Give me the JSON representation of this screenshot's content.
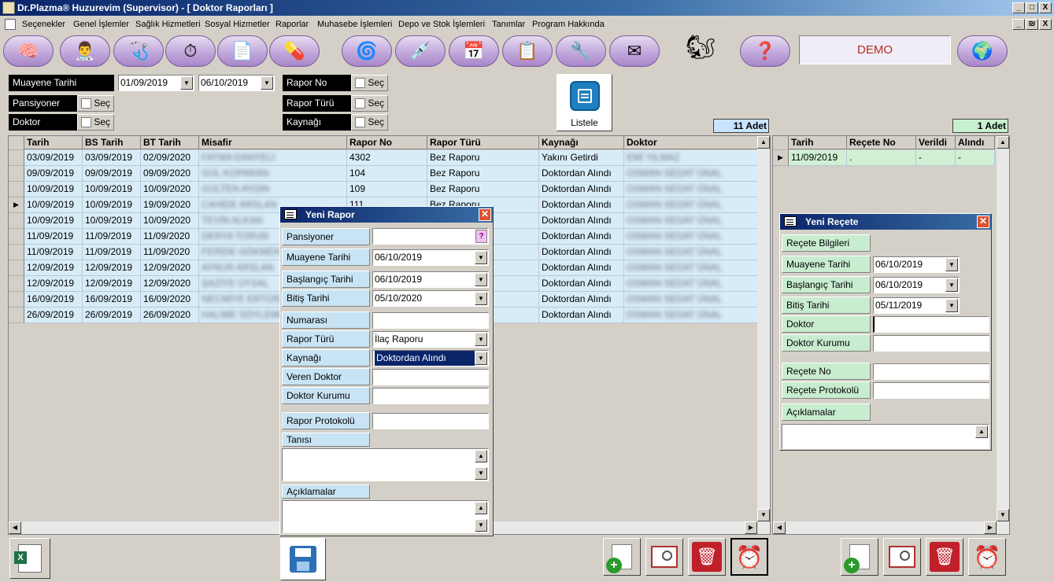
{
  "window": {
    "title": "Dr.Plazma® Huzurevim (Supervisor) - [ Doktor Raporları ]",
    "min": "_",
    "max": "□",
    "close": "X",
    "child_min": "_",
    "child_restore": "₪",
    "child_close": "X"
  },
  "menu": [
    "Seçenekler",
    "Genel İşlemler",
    "Sağlık Hizmetleri",
    "Sosyal Hizmetler",
    "Raporlar",
    "Muhasebe İşlemleri",
    "Depo ve Stok İşlemleri",
    "Tanımlar",
    "Program Hakkında"
  ],
  "toolbar": {
    "demo_label": "DEMO",
    "icons": [
      "help-head-icon",
      "doctors-icon",
      "medical-icon",
      "clock-icon",
      "word-doc-icon",
      "pills-icon",
      "spiral-icon",
      "syringe-icon",
      "calendar-icon",
      "clipboard-icon",
      "tools-icon",
      "mail-icon",
      "squirrel-icon",
      "help-note-icon",
      "globe-icon"
    ]
  },
  "filters": {
    "muayene_label": "Muayene Tarihi",
    "date_from": "01/09/2019",
    "date_to": "06/10/2019",
    "pansiyoner_label": "Pansiyoner",
    "doktor_label": "Doktor",
    "rapor_no_label": "Rapor No",
    "rapor_turu_label": "Rapor Türü",
    "kaynagi_label": "Kaynağı",
    "sec_label": "Seç",
    "list_button": "Listele"
  },
  "counts": {
    "main": "11 Adet",
    "recipe": "1 Adet"
  },
  "main_table": {
    "columns": [
      "Tarih",
      "BS Tarih",
      "BT Tarih",
      "Misafir",
      "Rapor No",
      "Rapor Türü",
      "Kaynağı",
      "Doktor"
    ],
    "rows": [
      [
        "03/09/2019",
        "03/09/2019",
        "02/09/2020",
        "FATMA DANYELİ",
        "4302",
        "Bez Raporu",
        "Yakını Getirdi",
        "EMİ YILMAZ"
      ],
      [
        "09/09/2019",
        "09/09/2019",
        "09/09/2020",
        "GÜL KOPARAN",
        "104",
        "Bez Raporu",
        "Doktordan Alındı",
        "OSMAN SEDAT ÜNAL"
      ],
      [
        "10/09/2019",
        "10/09/2019",
        "10/09/2020",
        "GÜLTEN AYDIN",
        "109",
        "Bez Raporu",
        "Doktordan Alındı",
        "OSMAN SEDAT ÜNAL"
      ],
      [
        "10/09/2019",
        "10/09/2019",
        "19/09/2020",
        "CAHİDE ARSLAN",
        "111",
        "Bez Raporu",
        "Doktordan Alındı",
        "OSMAN SEDAT ÜNAL"
      ],
      [
        "10/09/2019",
        "10/09/2019",
        "10/09/2020",
        "TEVİN ALKAN",
        "",
        "",
        "Doktordan Alındı",
        "OSMAN SEDAT ÜNAL"
      ],
      [
        "11/09/2019",
        "11/09/2019",
        "11/09/2020",
        "DERYA TORUN",
        "",
        "",
        "Doktordan Alındı",
        "OSMAN SEDAT ÜNAL"
      ],
      [
        "11/09/2019",
        "11/09/2019",
        "11/09/2020",
        "FERİDE GÖKMEN",
        "",
        "",
        "Doktordan Alındı",
        "OSMAN SEDAT ÜNAL"
      ],
      [
        "12/09/2019",
        "12/09/2019",
        "12/09/2020",
        "AYNUR ARSLAN",
        "",
        "",
        "Doktordan Alındı",
        "OSMAN SEDAT ÜNAL"
      ],
      [
        "12/09/2019",
        "12/09/2019",
        "12/09/2020",
        "ŞAZİYE UYSAL",
        "",
        "",
        "Doktordan Alındı",
        "OSMAN SEDAT ÜNAL"
      ],
      [
        "16/09/2019",
        "16/09/2019",
        "16/09/2020",
        "NECMİYE ERTÜRK",
        "",
        "",
        "Doktordan Alındı",
        "OSMAN SEDAT ÜNAL"
      ],
      [
        "26/09/2019",
        "26/09/2019",
        "26/09/2020",
        "HALİME SÖYLEMEZ",
        "",
        "",
        "Doktordan Alındı",
        "OSMAN SEDAT ÜNAL"
      ]
    ],
    "selected_row": 3
  },
  "recipe_table": {
    "columns": [
      "Tarih",
      "Reçete No",
      "Verildi",
      "Alındı"
    ],
    "rows": [
      [
        "11/09/2019",
        ".",
        "-",
        "-"
      ]
    ]
  },
  "yeni_rapor": {
    "title": "Yeni Rapor",
    "pansiyoner_label": "Pansiyoner",
    "pansiyoner_value": "",
    "pick_button": "?",
    "muayene_label": "Muayene Tarihi",
    "muayene_value": "06/10/2019",
    "baslangic_label": "Başlangıç Tarihi",
    "baslangic_value": "06/10/2019",
    "bitis_label": "Bitiş Tarihi",
    "bitis_value": "05/10/2020",
    "numarasi_label": "Numarası",
    "numarasi_value": "",
    "rapor_turu_label": "Rapor Türü",
    "rapor_turu_value": "İlaç Raporu",
    "kaynagi_label": "Kaynağı",
    "kaynagi_value": "Doktordan Alındı",
    "veren_doktor_label": "Veren Doktor",
    "doktor_kurumu_label": "Doktor Kurumu",
    "rapor_protokolu_label": "Rapor Protokolü",
    "tanisi_label": "Tanısı",
    "aciklamalar_label": "Açıklamalar"
  },
  "yeni_recete": {
    "title": "Yeni Reçete",
    "bilgileri_label": "Reçete Bilgileri",
    "muayene_label": "Muayene Tarihi",
    "muayene_value": "06/10/2019",
    "baslangic_label": "Başlangıç Tarihi",
    "baslangic_value": "06/10/2019",
    "bitis_label": "Bitiş Tarihi",
    "bitis_value": "05/11/2019",
    "doktor_label": "Doktor",
    "doktor_kurumu_label": "Doktor Kurumu",
    "recete_no_label": "Reçete No",
    "recete_protokolu_label": "Reçete Protokolü",
    "aciklamalar_label": "Açıklamalar"
  }
}
